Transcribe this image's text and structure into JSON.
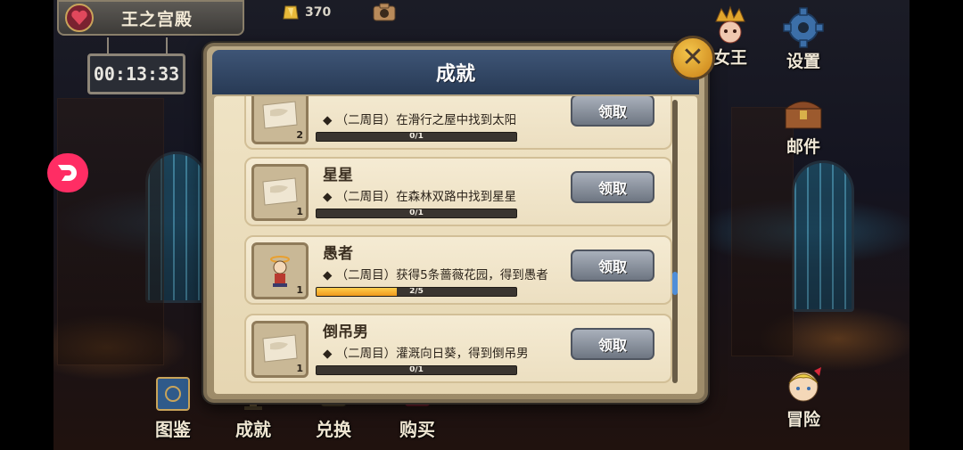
{
  "location": {
    "name": "王之宫殿"
  },
  "currency": {
    "value": "370",
    "icon": "gold-crystal-icon"
  },
  "timer": "00:13:33",
  "right_menu": [
    {
      "key": "queen",
      "label": "女王",
      "icon": "queen-icon"
    },
    {
      "key": "settings",
      "label": "设置",
      "icon": "gear-icon"
    },
    {
      "key": "mail",
      "label": "邮件",
      "icon": "chest-icon"
    },
    {
      "key": "adventure",
      "label": "冒险",
      "icon": "character-icon"
    }
  ],
  "bottom_menu": [
    {
      "key": "guide",
      "label": "图鉴",
      "icon": "book-icon"
    },
    {
      "key": "achievements",
      "label": "成就",
      "icon": "trophy-icon"
    },
    {
      "key": "exchange",
      "label": "兑换",
      "icon": "exchange-icon"
    },
    {
      "key": "purchase",
      "label": "购买",
      "icon": "shop-icon"
    }
  ],
  "modal": {
    "title": "成就",
    "close_label": "✕",
    "claim_label": "领取",
    "achievements": [
      {
        "name": "",
        "description": "◆ （二周目）在滑行之屋中找到太阳",
        "count": "2",
        "progress_text": "0/1",
        "progress": 0,
        "icon": "ticket-icon"
      },
      {
        "name": "星星",
        "description": "◆ （二周目）在森林双路中找到星星",
        "count": "1",
        "progress_text": "0/1",
        "progress": 0,
        "icon": "ticket-icon"
      },
      {
        "name": "愚者",
        "description": "◆ （二周目）获得5条蔷薇花园，得到愚者",
        "count": "1",
        "progress_text": "2/5",
        "progress": 0.4,
        "icon": "fool-character-icon"
      },
      {
        "name": "倒吊男",
        "description": "◆ （二周目）灌溉向日葵，得到倒吊男",
        "count": "1",
        "progress_text": "0/1",
        "progress": 0,
        "icon": "ticket-icon"
      }
    ]
  },
  "colors": {
    "header_blue": "#283a55",
    "progress_orange": "#f09a1c",
    "pink_button": "#ff2d64",
    "scroll_thumb": "#4f8ed8"
  }
}
